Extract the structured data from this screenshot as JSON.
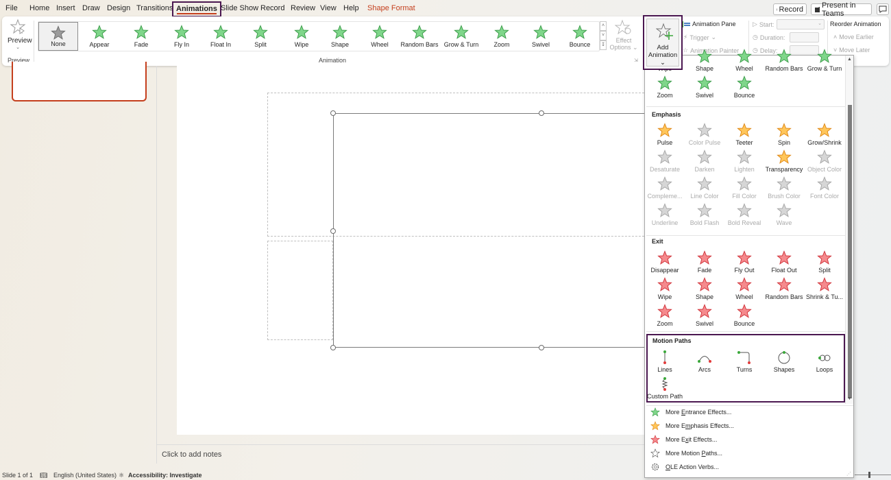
{
  "menubar": {
    "items": [
      "File",
      "Home",
      "Insert",
      "Draw",
      "Design",
      "Transitions",
      "Animations",
      "Slide Show",
      "Record",
      "Review",
      "View",
      "Help",
      "Shape Format"
    ],
    "active": "Animations",
    "record_button": "Record",
    "present_button": "Present in Teams"
  },
  "ribbon": {
    "preview": {
      "label": "Preview",
      "group_label": "Preview"
    },
    "animation_group_label": "Animation",
    "gallery": [
      {
        "label": "None",
        "color": "gray",
        "selected": true
      },
      {
        "label": "Appear",
        "color": "green"
      },
      {
        "label": "Fade",
        "color": "green"
      },
      {
        "label": "Fly In",
        "color": "green"
      },
      {
        "label": "Float In",
        "color": "green"
      },
      {
        "label": "Split",
        "color": "green"
      },
      {
        "label": "Wipe",
        "color": "green"
      },
      {
        "label": "Shape",
        "color": "green"
      },
      {
        "label": "Wheel",
        "color": "green"
      },
      {
        "label": "Random Bars",
        "color": "green"
      },
      {
        "label": "Grow & Turn",
        "color": "green"
      },
      {
        "label": "Zoom",
        "color": "green"
      },
      {
        "label": "Swivel",
        "color": "green"
      },
      {
        "label": "Bounce",
        "color": "green"
      }
    ],
    "effect_options": {
      "line1": "Effect",
      "line2": "Options"
    },
    "add_animation": {
      "line1": "Add",
      "line2": "Animation"
    },
    "animation_pane": "Animation Pane",
    "trigger": "Trigger",
    "animation_painter": "Animation Painter",
    "start_label": "Start:",
    "duration_label": "Duration:",
    "delay_label": "Delay:",
    "reorder_title": "Reorder Animation",
    "move_earlier": "Move Earlier",
    "move_later": "Move Later"
  },
  "dropdown": {
    "entrance_partial": [
      "Wipe",
      "Shape",
      "Wheel",
      "Random Bars",
      "Grow & Turn",
      "Zoom",
      "Swivel",
      "Bounce"
    ],
    "emphasis": {
      "title": "Emphasis",
      "items": [
        {
          "label": "Pulse",
          "enabled": true
        },
        {
          "label": "Color Pulse",
          "enabled": false
        },
        {
          "label": "Teeter",
          "enabled": true
        },
        {
          "label": "Spin",
          "enabled": true
        },
        {
          "label": "Grow/Shrink",
          "enabled": true
        },
        {
          "label": "Desaturate",
          "enabled": false
        },
        {
          "label": "Darken",
          "enabled": false
        },
        {
          "label": "Lighten",
          "enabled": false
        },
        {
          "label": "Transparency",
          "enabled": true
        },
        {
          "label": "Object Color",
          "enabled": false
        },
        {
          "label": "Compleme...",
          "enabled": false
        },
        {
          "label": "Line Color",
          "enabled": false
        },
        {
          "label": "Fill Color",
          "enabled": false
        },
        {
          "label": "Brush Color",
          "enabled": false
        },
        {
          "label": "Font Color",
          "enabled": false
        },
        {
          "label": "Underline",
          "enabled": false
        },
        {
          "label": "Bold Flash",
          "enabled": false
        },
        {
          "label": "Bold Reveal",
          "enabled": false
        },
        {
          "label": "Wave",
          "enabled": false
        }
      ]
    },
    "exit": {
      "title": "Exit",
      "items": [
        "Disappear",
        "Fade",
        "Fly Out",
        "Float Out",
        "Split",
        "Wipe",
        "Shape",
        "Wheel",
        "Random Bars",
        "Shrink & Tu...",
        "Zoom",
        "Swivel",
        "Bounce"
      ]
    },
    "motion_paths": {
      "title": "Motion Paths",
      "items": [
        "Lines",
        "Arcs",
        "Turns",
        "Shapes",
        "Loops",
        "Custom Path"
      ]
    },
    "more": [
      {
        "icon": "entrance-star-icon",
        "pre": "More ",
        "key": "E",
        "post": "ntrance Effects..."
      },
      {
        "icon": "emphasis-star-icon",
        "pre": "More E",
        "key": "m",
        "post": "phasis Effects..."
      },
      {
        "icon": "exit-star-icon",
        "pre": "More E",
        "key": "x",
        "post": "it Effects..."
      },
      {
        "icon": "motion-path-star-icon",
        "pre": "More Motion ",
        "key": "P",
        "post": "aths..."
      },
      {
        "icon": "gear-icon",
        "pre": "",
        "key": "O",
        "post": "LE Action Verbs..."
      }
    ]
  },
  "notes": {
    "placeholder": "Click to add notes"
  },
  "status": {
    "slide": "Slide 1 of 1",
    "language": "English (United States)",
    "accessibility": "Accessibility: Investigate"
  },
  "colors": {
    "accent": "#c43e1c",
    "highlight_border": "#4a1750",
    "entrance": "#5cb85c",
    "emphasis": "#f0a830",
    "exit": "#e8565b"
  }
}
